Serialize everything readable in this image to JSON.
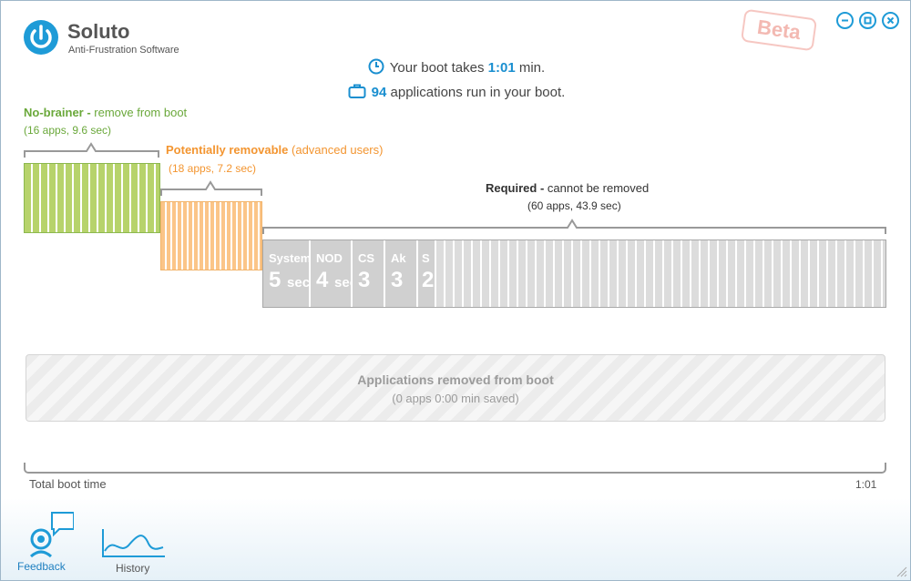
{
  "app": {
    "title": "Soluto",
    "subtitle": "Anti-Frustration Software",
    "beta_label": "Beta"
  },
  "icons": {
    "logo": "power-icon",
    "minimize": "minimize-icon",
    "maximize": "maximize-icon",
    "close": "close-icon",
    "clock": "clock-icon",
    "briefcase": "briefcase-icon",
    "feedback": "feedback-icon",
    "history": "history-icon"
  },
  "colors": {
    "accent": "#1a8fd0",
    "no_brainer": "#6aa83a",
    "potentially_removable": "#f39530",
    "required": "#333333"
  },
  "summary": {
    "boot_prefix": "Your boot takes",
    "boot_time": "1:01",
    "boot_suffix": "min.",
    "apps_count": "94",
    "apps_suffix": "applications run in your boot."
  },
  "groups": {
    "no_brainer": {
      "title": "No-brainer -",
      "desc": "remove from boot",
      "stats": "(16 apps, 9.6 sec)"
    },
    "potentially_removable": {
      "title": "Potentially removable",
      "desc": "(advanced users)",
      "stats": "(18 apps, 7.2 sec)"
    },
    "required": {
      "title": "Required -",
      "desc": "cannot be removed",
      "stats": "(60 apps, 43.9 sec)",
      "segments": [
        {
          "name": "System",
          "time": "5",
          "unit": "sec"
        },
        {
          "name": "NOD",
          "time": "4",
          "unit": "sec"
        },
        {
          "name": "CS",
          "time": "3",
          "unit": ""
        },
        {
          "name": "Ak",
          "time": "3",
          "unit": ""
        },
        {
          "name": "S",
          "time": "2",
          "unit": ""
        }
      ]
    }
  },
  "removed": {
    "title": "Applications removed from boot",
    "subtitle": "(0 apps 0:00 min saved)"
  },
  "timeline": {
    "label": "Total boot time",
    "end_value": "1:01"
  },
  "nav": {
    "feedback_label": "Feedback",
    "history_label": "History"
  }
}
